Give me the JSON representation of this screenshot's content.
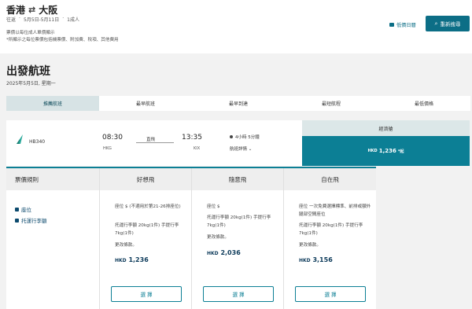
{
  "header": {
    "origin": "香港",
    "swap_icon": "⇄",
    "destination": "大阪",
    "trip_type": "往返",
    "dates": "5月5日-5月11日",
    "passengers": "1成人",
    "note1": "票價以每位成人單價顯示",
    "note2": "*所顯示之每位票價包括機票價、附加費、稅項、其他費用",
    "calendar_label": "低價日曆",
    "search_label": "重新搜尋"
  },
  "page": {
    "title": "出發航班",
    "date": "2025年5月5日, 星期一"
  },
  "sort_tabs": [
    "推薦航班",
    "最早航班",
    "最早到達",
    "最短航程",
    "最低價格"
  ],
  "flight": {
    "number": "HB340",
    "dep_time": "08:30",
    "dep_code": "HKG",
    "stop_label": "直飛",
    "arr_time": "13:35",
    "arr_code": "KIX",
    "duration": "4小時 5分鐘",
    "details": "航班詳情 ⌄"
  },
  "cabin": {
    "name": "經濟艙",
    "currency": "HKD",
    "price": "1,236",
    "suffix": "*起"
  },
  "fares": {
    "rules_title": "票價規則",
    "rule_items": [
      "座位",
      "托運行李額"
    ],
    "columns": [
      {
        "name": "好想飛",
        "seat": "座位 $ (不適用於第21-26排座位)",
        "baggage": "托運行李額 20kg(1件) 手提行李 7kg(1件)",
        "change": "更改條款。",
        "currency": "HKD",
        "price": "1,236",
        "button": "選 擇"
      },
      {
        "name": "隨意飛",
        "seat": "座位 $",
        "baggage": "托運行李額 20kg(1件) 手提行李 7kg(1件)",
        "change": "更改條款。",
        "currency": "HKD",
        "price": "2,036",
        "button": "選 擇"
      },
      {
        "name": "自在飛",
        "seat": "座位 一次免費選擇標準、前排或額外腿部空間座位",
        "baggage": "托運行李額 20kg(1件) 手提行李 7kg(1件)",
        "change": "更改條款。",
        "currency": "HKD",
        "price": "3,156",
        "button": "選 擇"
      }
    ]
  },
  "colors": {
    "brand": "#0c7f95",
    "accent": "#0c6e86"
  }
}
